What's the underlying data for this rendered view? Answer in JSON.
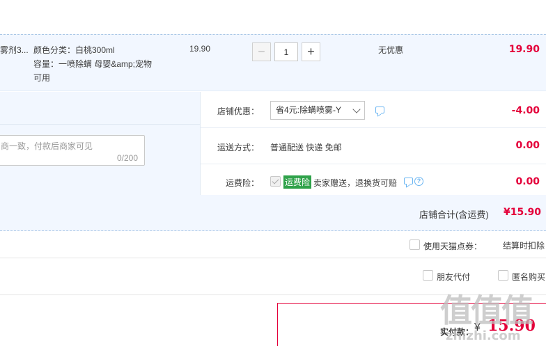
{
  "item": {
    "name_fragment": "雾剂3...",
    "sku_color": "颜色分类：白桃300ml",
    "sku_capacity_line1": "容量：一喷除螨 母婴&amp;宠物",
    "sku_capacity_line2": "可用",
    "unit_price": "19.90",
    "quantity": "1",
    "minus_glyph": "−",
    "plus_glyph": "+",
    "discount": "无优惠",
    "total": "19.90"
  },
  "order": {
    "shop_coupon_label": "店铺优惠：",
    "shop_coupon_value": "省4元:除螨喷雾-Y",
    "shop_coupon_amount": "-4.00",
    "delivery_label": "运送方式：",
    "delivery_value": "普通配送 快递 免邮",
    "delivery_amount": "0.00",
    "insurance_label": "运费险：",
    "insurance_tag": "运费险",
    "insurance_text": "卖家赠送，退换货可赔",
    "insurance_amount": "0.00",
    "message_placeholder": "商一致，付款后商家可见",
    "message_count": "0/200"
  },
  "subtotal": {
    "label": "店铺合计(含运费)",
    "value": "¥15.90"
  },
  "options": {
    "tmall_points_label": "使用天猫点券：",
    "tmall_points_note": "结算时扣除",
    "friend_pay_label": "朋友代付",
    "anonymous_label": "匿名购买"
  },
  "payment": {
    "label": "实付款：",
    "currency": "¥",
    "value": "15.90"
  },
  "watermark": {
    "logo": "值值值",
    "domain": "zhizhi.com"
  },
  "colors": {
    "price_red": "#e4003a",
    "row_bg": "#f2f7ff",
    "tag_green": "#2fa24a",
    "icon_blue": "#6cb6f2"
  },
  "icons": {
    "coupon_chat": "chat-bubble-icon",
    "insurance_chat": "chat-bubble-icon",
    "insurance_help": "question-circle-icon",
    "select_arrow": "chevron-down-icon"
  }
}
